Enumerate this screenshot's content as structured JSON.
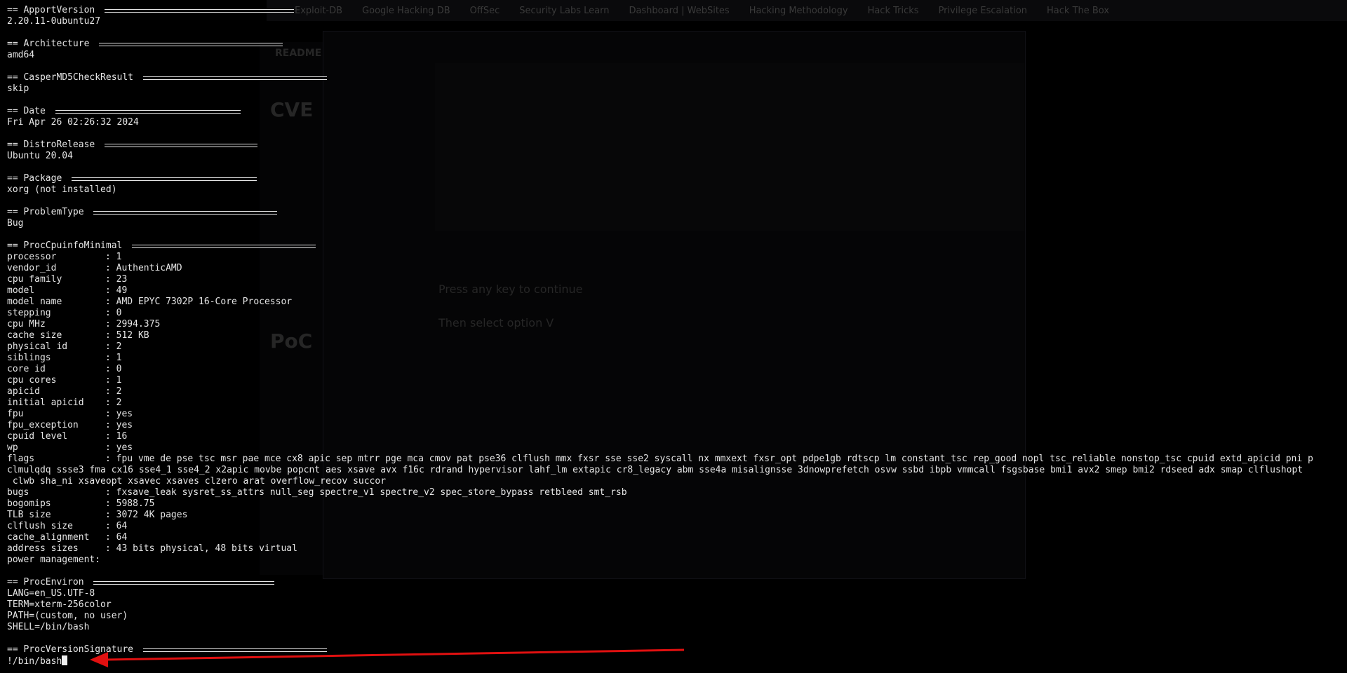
{
  "terminal": {
    "sections": {
      "apport_version": {
        "header": "== ApportVersion ",
        "value": "2.20.11-0ubuntu27"
      },
      "architecture": {
        "header": "== Architecture ",
        "value": "amd64"
      },
      "casper": {
        "header": "== CasperMD5CheckResult ",
        "value": "skip"
      },
      "date": {
        "header": "== Date ",
        "value": "Fri Apr 26 02:26:32 2024"
      },
      "distro": {
        "header": "== DistroRelease ",
        "value": "Ubuntu 20.04"
      },
      "package": {
        "header": "== Package ",
        "value": "xorg (not installed)"
      },
      "problem_type": {
        "header": "== ProblemType ",
        "value": "Bug"
      },
      "cpuinfo": {
        "header": "== ProcCpuinfoMinimal ",
        "rows": [
          {
            "key": "processor",
            "value": "1"
          },
          {
            "key": "vendor_id",
            "value": "AuthenticAMD"
          },
          {
            "key": "cpu family",
            "value": "23"
          },
          {
            "key": "model",
            "value": "49"
          },
          {
            "key": "model name",
            "value": "AMD EPYC 7302P 16-Core Processor"
          },
          {
            "key": "stepping",
            "value": "0"
          },
          {
            "key": "cpu MHz",
            "value": "2994.375"
          },
          {
            "key": "cache size",
            "value": "512 KB"
          },
          {
            "key": "physical id",
            "value": "2"
          },
          {
            "key": "siblings",
            "value": "1"
          },
          {
            "key": "core id",
            "value": "0"
          },
          {
            "key": "cpu cores",
            "value": "1"
          },
          {
            "key": "apicid",
            "value": "2"
          },
          {
            "key": "initial apicid",
            "value": "2"
          },
          {
            "key": "fpu",
            "value": "yes"
          },
          {
            "key": "fpu_exception",
            "value": "yes"
          },
          {
            "key": "cpuid level",
            "value": "16"
          },
          {
            "key": "wp",
            "value": "yes"
          }
        ],
        "flags_key": "flags",
        "flags_value": "fpu vme de pse tsc msr pae mce cx8 apic sep mtrr pge mca cmov pat pse36 clflush mmx fxsr sse sse2 syscall nx mmxext fxsr_opt pdpe1gb rdtscp lm constant_tsc rep_good nopl tsc_reliable nonstop_tsc cpuid extd_apicid pni p",
        "flags_wrap_1": "clmulqdq ssse3 fma cx16 sse4_1 sse4_2 x2apic movbe popcnt aes xsave avx f16c rdrand hypervisor lahf_lm extapic cr8_legacy abm sse4a misalignsse 3dnowprefetch osvw ssbd ibpb vmmcall fsgsbase bmi1 avx2 smep bmi2 rdseed adx smap clflushopt",
        "flags_wrap_2": " clwb sha_ni xsaveopt xsavec xsaves clzero arat overflow_recov succor",
        "rows_after": [
          {
            "key": "bugs",
            "value": "fxsave_leak sysret_ss_attrs null_seg spectre_v1 spectre_v2 spec_store_bypass retbleed smt_rsb"
          },
          {
            "key": "bogomips",
            "value": "5988.75"
          },
          {
            "key": "TLB size",
            "value": "3072 4K pages"
          },
          {
            "key": "clflush size",
            "value": "64"
          },
          {
            "key": "cache_alignment",
            "value": "64"
          },
          {
            "key": "address sizes",
            "value": "43 bits physical, 48 bits virtual"
          }
        ],
        "power_line": "power management:"
      },
      "environ": {
        "header": "== ProcEnviron ",
        "lines": [
          "LANG=en_US.UTF-8",
          "TERM=xterm-256color",
          "PATH=(custom, no user)",
          "SHELL=/bin/bash"
        ]
      },
      "signature": {
        "header": "== ProcVersionSignature ",
        "prompt": "!/bin/bash"
      }
    },
    "kv_separator": ": "
  },
  "background": {
    "tabs": [
      "Exploit-DB",
      "Google Hacking DB",
      "OffSec",
      "Security Labs Learn",
      "Dashboard | WebSites",
      "Hacking Methodology",
      "Hack Tricks",
      "Privilege Escalation",
      "Hack The Box"
    ],
    "readme_label": "README",
    "cve_heading": "CVE",
    "poc_heading": "PoC",
    "ghost_prompt": "Press any key to continue",
    "ghost_option": "Then select option V"
  },
  "colors": {
    "terminal_bg": "#000000",
    "terminal_fg": "#e6e6e6",
    "arrow": "#e01010"
  }
}
